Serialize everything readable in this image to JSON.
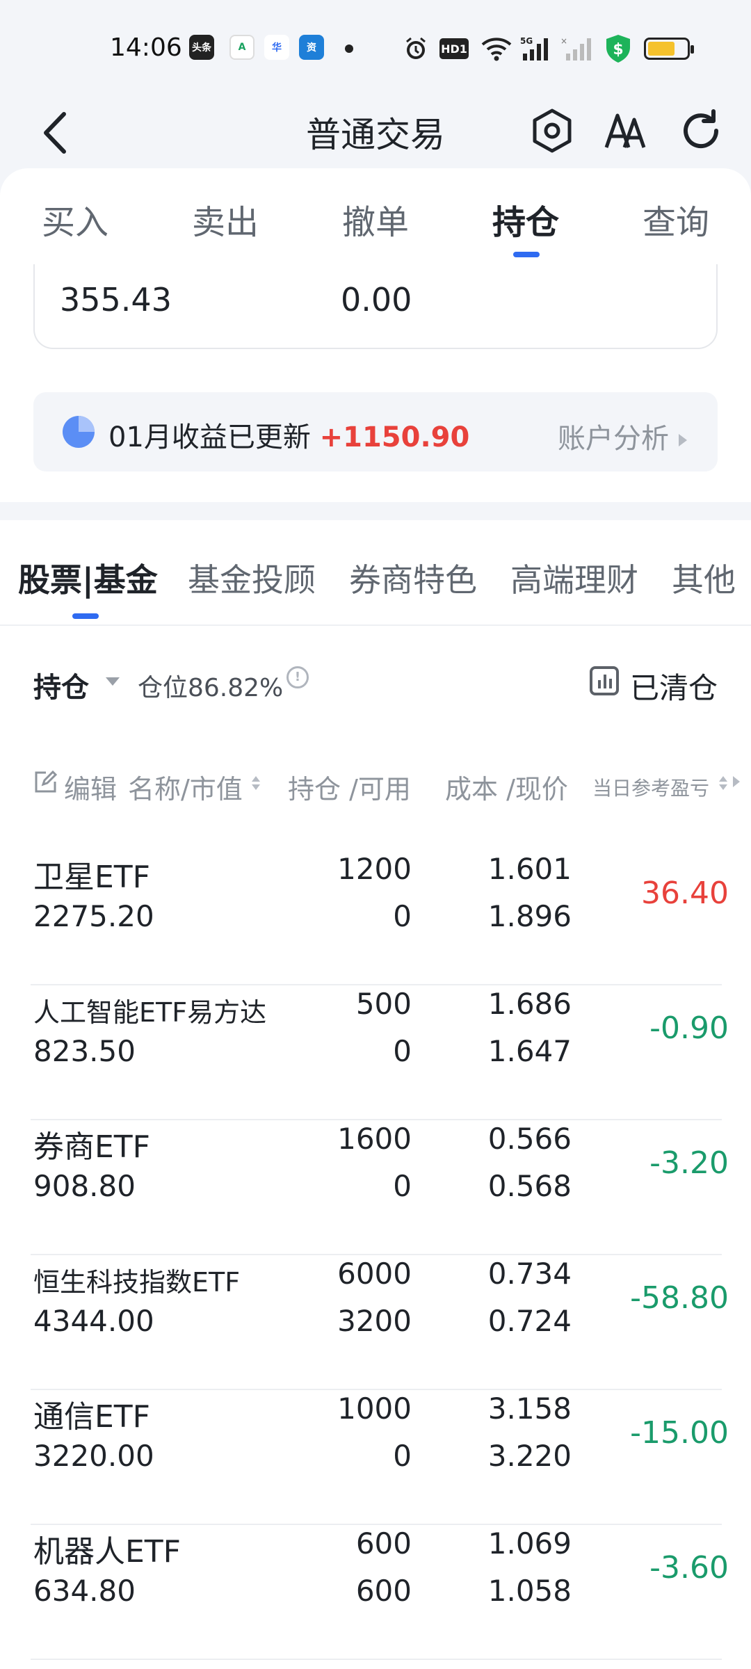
{
  "status_bar": {
    "time": "14:06",
    "apps": [
      "头条",
      "A",
      "华",
      "资"
    ],
    "icons": [
      "alarm-icon",
      "hd-icon",
      "wifi-icon",
      "signal-5g-icon",
      "signal-icon",
      "shield-dollar-icon",
      "battery-icon"
    ],
    "hd_label": "HD1",
    "net_label": "5G"
  },
  "header": {
    "title": "普通交易",
    "back_icon": "chevron-left-icon",
    "actions": [
      "hexagon-settings-icon",
      "font-size-icon",
      "refresh-icon"
    ]
  },
  "trade_tabs": {
    "items": [
      "买入",
      "卖出",
      "撤单",
      "持仓",
      "查询"
    ],
    "active": "持仓"
  },
  "account_values": [
    "355.43",
    "0.00"
  ],
  "income_banner": {
    "text": "01月收益已更新",
    "amount": "+1150.90",
    "link": "账户分析"
  },
  "category_tabs": {
    "items": [
      "股票|基金",
      "基金投顾",
      "券商特色",
      "高端理财",
      "其他"
    ],
    "active": "股票|基金"
  },
  "position_bar": {
    "label": "持仓",
    "ratio": "仓位86.82%",
    "info": "!",
    "cleared": "已清仓"
  },
  "table_header": {
    "edit": "编辑",
    "name": "名称/市值",
    "hold": "持仓 /可用",
    "cost": "成本 /现价",
    "pl": "当日参考盈亏"
  },
  "holdings": [
    {
      "name": "卫星ETF",
      "market_value": "2275.20",
      "hold": "1200",
      "available": "0",
      "cost": "1.601",
      "price": "1.896",
      "pl": "36.40",
      "dir": "up"
    },
    {
      "name": "人工智能ETF易方达",
      "market_value": "823.50",
      "hold": "500",
      "available": "0",
      "cost": "1.686",
      "price": "1.647",
      "pl": "-0.90",
      "dir": "down"
    },
    {
      "name": "券商ETF",
      "market_value": "908.80",
      "hold": "1600",
      "available": "0",
      "cost": "0.566",
      "price": "0.568",
      "pl": "-3.20",
      "dir": "down"
    },
    {
      "name": "恒生科技指数ETF",
      "market_value": "4344.00",
      "hold": "6000",
      "available": "3200",
      "cost": "0.734",
      "price": "0.724",
      "pl": "-58.80",
      "dir": "down"
    },
    {
      "name": "通信ETF",
      "market_value": "3220.00",
      "hold": "1000",
      "available": "0",
      "cost": "3.158",
      "price": "3.220",
      "pl": "-15.00",
      "dir": "down"
    },
    {
      "name": "机器人ETF",
      "market_value": "634.80",
      "hold": "600",
      "available": "600",
      "cost": "1.069",
      "price": "1.058",
      "pl": "-3.60",
      "dir": "down"
    }
  ],
  "colors": {
    "accent": "#2f6bf1",
    "up": "#e8413b",
    "down": "#1a9b6b"
  }
}
